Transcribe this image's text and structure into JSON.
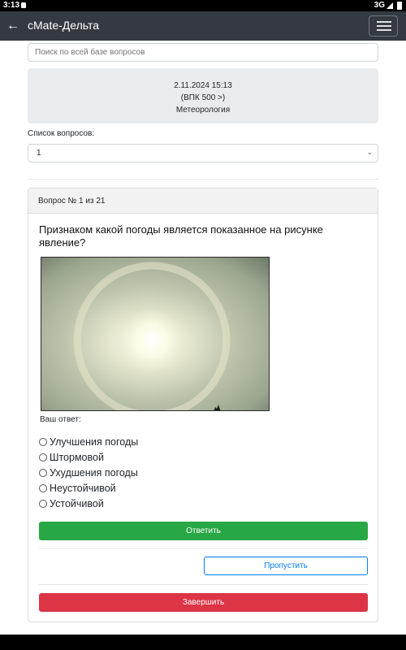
{
  "status_bar": {
    "time": "3:13",
    "network": "3G"
  },
  "app_bar": {
    "title": "cMate-Дельта"
  },
  "search": {
    "placeholder": "Поиск по всей базе вопросов"
  },
  "info": {
    "date": "2.11.2024 15:13",
    "subtitle": "(ВПК 500 >)",
    "topic": "Метеорология"
  },
  "question_list": {
    "label": "Список вопросов:",
    "selected": "1"
  },
  "card": {
    "header": "Вопрос № 1 из 21",
    "question": "Признаком какой погоды является показанное на рисунке явление?",
    "answer_label": "Ваш ответ:",
    "options": [
      "Улучшения погоды",
      "Штормовой",
      "Ухудшения погоды",
      "Неустойчивой",
      "Устойчивой"
    ],
    "answer_button": "Ответить",
    "skip_button": "Пропустить",
    "finish_button": "Завершить"
  },
  "colors": {
    "app_bar": "#343a40",
    "answer": "#28a745",
    "skip": "#007bff",
    "finish": "#dc3545",
    "info_bg": "#e9ecef"
  }
}
